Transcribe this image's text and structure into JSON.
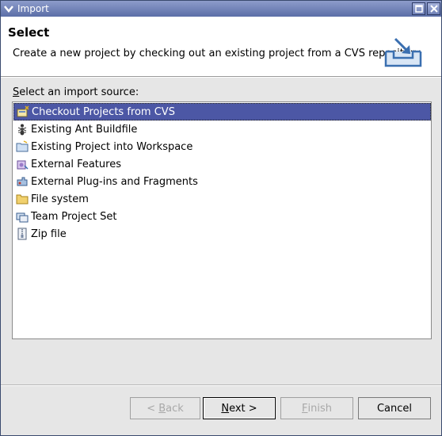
{
  "window": {
    "title": "Import"
  },
  "header": {
    "title": "Select",
    "description": "Create a new project by checking out an existing project from a CVS repository.",
    "icon": "import-wizard-icon"
  },
  "source_label": {
    "mnemonic": "S",
    "rest": "elect an import source:"
  },
  "sources": [
    {
      "label": "Checkout Projects from CVS",
      "icon": "cvs-checkout-icon",
      "selected": true
    },
    {
      "label": "Existing Ant Buildfile",
      "icon": "ant-icon",
      "selected": false
    },
    {
      "label": "Existing Project into Workspace",
      "icon": "project-folder-icon",
      "selected": false
    },
    {
      "label": "External Features",
      "icon": "features-icon",
      "selected": false
    },
    {
      "label": "External Plug-ins and Fragments",
      "icon": "plugin-icon",
      "selected": false
    },
    {
      "label": "File system",
      "icon": "folder-icon",
      "selected": false
    },
    {
      "label": "Team Project Set",
      "icon": "team-project-icon",
      "selected": false
    },
    {
      "label": "Zip file",
      "icon": "zip-icon",
      "selected": false
    }
  ],
  "buttons": {
    "back": {
      "prefix": "< ",
      "mnemonic": "B",
      "rest": "ack",
      "enabled": false
    },
    "next": {
      "mnemonic": "N",
      "rest": "ext >",
      "enabled": true
    },
    "finish": {
      "mnemonic": "F",
      "rest": "inish",
      "enabled": false
    },
    "cancel": {
      "label": "Cancel",
      "enabled": true
    }
  },
  "colors": {
    "selection": "#4c57a5",
    "titlebar": "#5b6ea7"
  }
}
